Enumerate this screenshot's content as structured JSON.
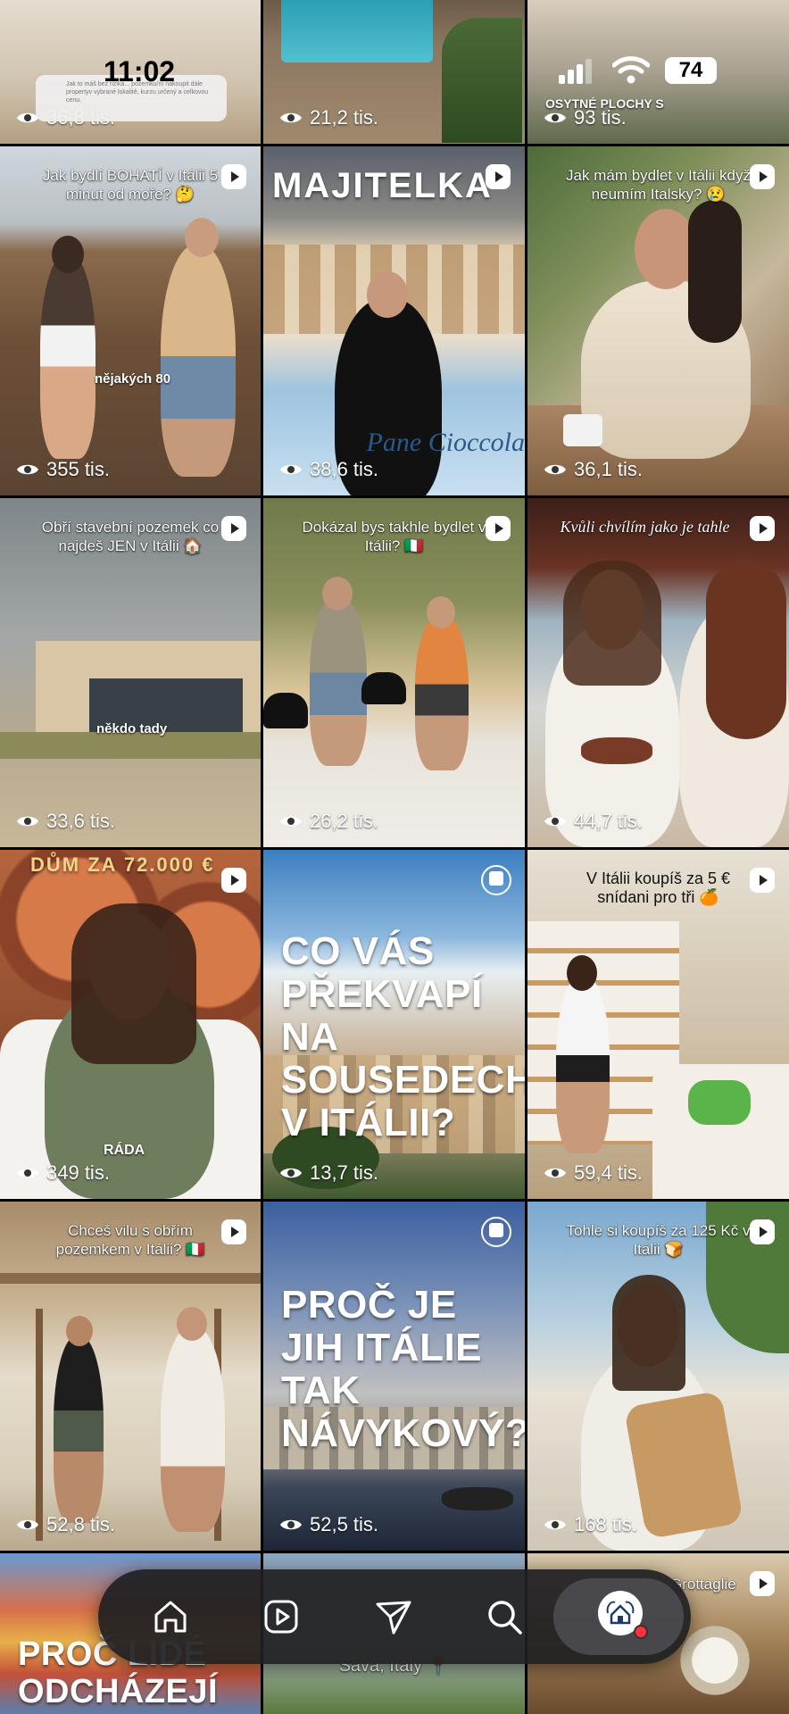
{
  "status_bar": {
    "time": "11:02",
    "battery": "74"
  },
  "notification": {
    "text": "Jak to máš bez rizika... pozemku/ní nakoupit dále propertyv vybrané lokalitě, kurzu určený a celkovou cenu."
  },
  "tiles": [
    {
      "views": "36,8 tis."
    },
    {
      "views": "21,2 tis."
    },
    {
      "views": "93 tis.",
      "overlay": "OSYTNÉ PLOCHY S"
    },
    {
      "caption": "Jak bydlí BOHATÍ v Itálii 5 minut od moře? 🤔",
      "overlay": "nějakých 80",
      "views": "355 tis."
    },
    {
      "banner": "MAJITELKA",
      "sign": "Pane Cioccola",
      "views": "38,6 tis."
    },
    {
      "caption": "Jak mám bydlet v Itálii když neumím Italsky? 😢",
      "views": "36,1 tis."
    },
    {
      "caption": "Obří stavební pozemek co najdeš JEN v Itálii 🏠",
      "overlay": "někdo tady",
      "views": "33,6 tis."
    },
    {
      "caption": "Dokázal bys takhle bydlet v Itálii? 🇮🇹",
      "views": "26,2 tis."
    },
    {
      "caption": "Kvůli chvílím jako je tahle",
      "views": "44,7 tis."
    },
    {
      "banner": "DŮM ZA 72.000 €",
      "overlay": "RÁDA",
      "views": "349 tis."
    },
    {
      "big": "CO VÁS PŘEKVAPÍ NA SOUSEDECH V ITÁLII?",
      "views": "13,7 tis."
    },
    {
      "caption": "V Itálii koupíš za 5 € snídani pro tři 🍊",
      "views": "59,4 tis."
    },
    {
      "caption": "Chceš vilu s obřím pozemkem v Itálii? 🇮🇹",
      "views": "52,8 tis."
    },
    {
      "big": "PROČ JE JIH ITÁLIE TAK NÁVYKOVÝ?",
      "views": "52,5 tis."
    },
    {
      "caption": "Tohle si koupíš za 125 Kč v Itálii 🍞",
      "views": "168 tis."
    },
    {
      "big": "PROČ LIDÉ ODCHÁZEJÍ"
    },
    {
      "caption": "Sava, Italy 📍"
    },
    {
      "caption": "Grottaglie"
    }
  ],
  "nav": {
    "items": [
      "home-icon",
      "reels-icon",
      "send-icon",
      "search-icon",
      "profile-avatar"
    ]
  }
}
